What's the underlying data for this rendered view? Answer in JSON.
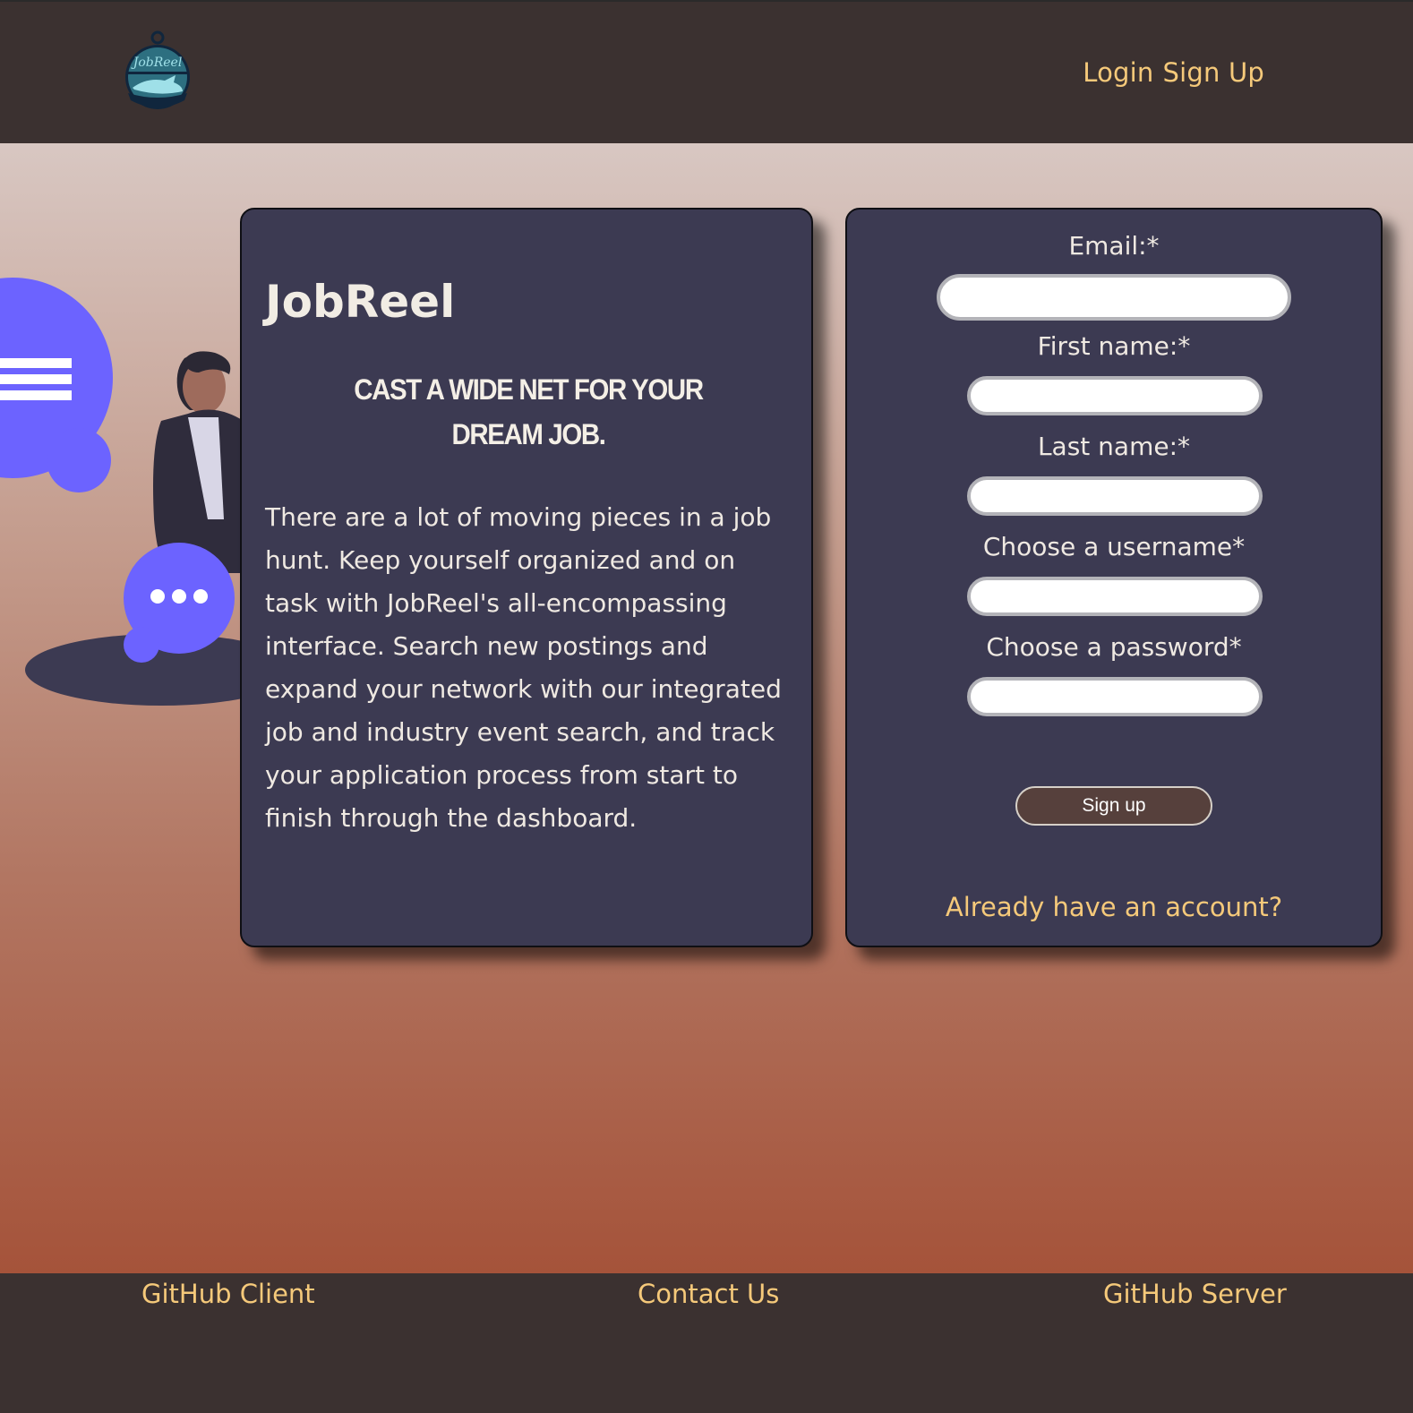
{
  "header": {
    "logo_text": "JobReel",
    "nav": {
      "login": "Login",
      "signup": "Sign Up"
    }
  },
  "info": {
    "brand": "JobReel",
    "tagline": "Cast a wide net for your dream job.",
    "description": "There are a lot of moving pieces in a job hunt. Keep yourself organized and on task with JobReel's all-encompassing interface. Search new postings and expand your network with our integrated job and industry event search, and track your application process from start to finish through the dashboard."
  },
  "form": {
    "email_label": "Email:*",
    "email_value": "",
    "first_name_label": "First name:*",
    "first_name_value": "",
    "last_name_label": "Last name:*",
    "last_name_value": "",
    "username_label": "Choose a username*",
    "username_value": "",
    "password_label": "Choose a password*",
    "password_value": "",
    "submit_label": "Sign up",
    "account_link": "Already have an account?"
  },
  "footer": {
    "github_client": "GitHub Client",
    "contact": "Contact Us",
    "github_server": "GitHub Server"
  },
  "colors": {
    "header_bg": "#3b3130",
    "card_bg": "#3c3a52",
    "link": "#f5c97a",
    "accent": "#6c63ff"
  }
}
